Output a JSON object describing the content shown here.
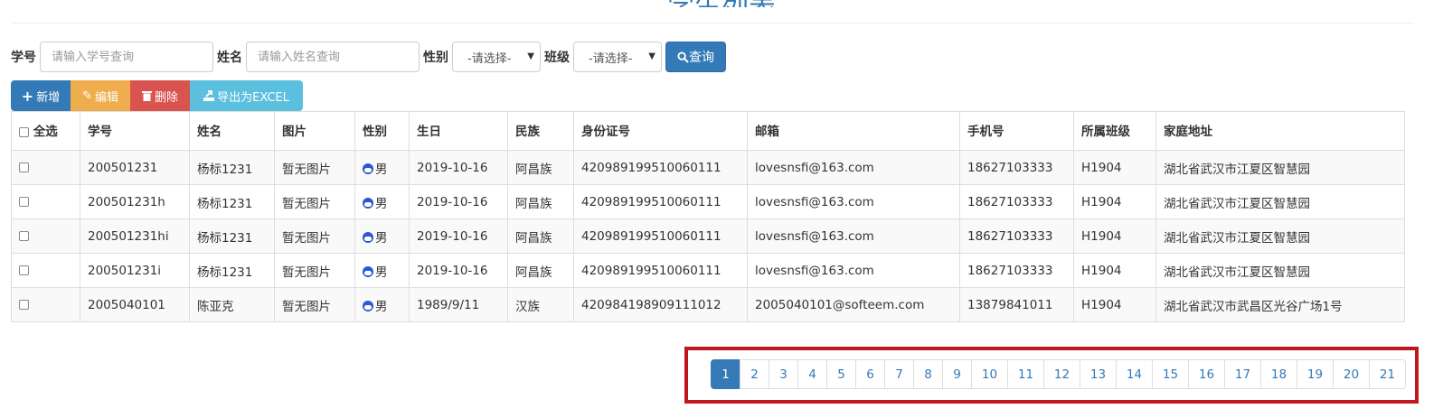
{
  "page": {
    "title": "学生列表"
  },
  "search": {
    "id_label": "学号",
    "id_placeholder": "请输入学号查询",
    "name_label": "姓名",
    "name_placeholder": "请输入姓名查询",
    "gender_label": "性别",
    "gender_selected": "-请选择-",
    "class_label": "班级",
    "class_selected": "-请选择-",
    "query_label": "查询"
  },
  "toolbar": {
    "add_label": "新增",
    "edit_label": "编辑",
    "delete_label": "删除",
    "export_label": "导出为EXCEL"
  },
  "table": {
    "headers": [
      "全选",
      "学号",
      "姓名",
      "图片",
      "性别",
      "生日",
      "民族",
      "身份证号",
      "邮箱",
      "手机号",
      "所属班级",
      "家庭地址"
    ],
    "rows": [
      {
        "id": "200501231",
        "name": "杨标1231",
        "photo": "暂无图片",
        "gender": "男",
        "birthday": "2019-10-16",
        "ethnicity": "阿昌族",
        "id_card": "420989199510060111",
        "email": "lovesnsfi@163.com",
        "phone": "18627103333",
        "class": "H1904",
        "address": "湖北省武汉市江夏区智慧园"
      },
      {
        "id": "200501231h",
        "name": "杨标1231",
        "photo": "暂无图片",
        "gender": "男",
        "birthday": "2019-10-16",
        "ethnicity": "阿昌族",
        "id_card": "420989199510060111",
        "email": "lovesnsfi@163.com",
        "phone": "18627103333",
        "class": "H1904",
        "address": "湖北省武汉市江夏区智慧园"
      },
      {
        "id": "200501231hi",
        "name": "杨标1231",
        "photo": "暂无图片",
        "gender": "男",
        "birthday": "2019-10-16",
        "ethnicity": "阿昌族",
        "id_card": "420989199510060111",
        "email": "lovesnsfi@163.com",
        "phone": "18627103333",
        "class": "H1904",
        "address": "湖北省武汉市江夏区智慧园"
      },
      {
        "id": "200501231i",
        "name": "杨标1231",
        "photo": "暂无图片",
        "gender": "男",
        "birthday": "2019-10-16",
        "ethnicity": "阿昌族",
        "id_card": "420989199510060111",
        "email": "lovesnsfi@163.com",
        "phone": "18627103333",
        "class": "H1904",
        "address": "湖北省武汉市江夏区智慧园"
      },
      {
        "id": "2005040101",
        "name": "陈亚克",
        "photo": "暂无图片",
        "gender": "男",
        "birthday": "1989/9/11",
        "ethnicity": "汉族",
        "id_card": "420984198909111012",
        "email": "2005040101@softeem.com",
        "phone": "13879841011",
        "class": "H1904",
        "address": "湖北省武汉市武昌区光谷广场1号"
      }
    ]
  },
  "pagination": {
    "current": "1",
    "pages": [
      "1",
      "2",
      "3",
      "4",
      "5",
      "6",
      "7",
      "8",
      "9",
      "10",
      "11",
      "12",
      "13",
      "14",
      "15",
      "16",
      "17",
      "18",
      "19",
      "20",
      "21"
    ]
  },
  "colors": {
    "primary": "#337ab7",
    "warning": "#f0ad4e",
    "danger": "#d9534f",
    "info": "#5bc0de",
    "highlight_frame": "#c0161e"
  }
}
